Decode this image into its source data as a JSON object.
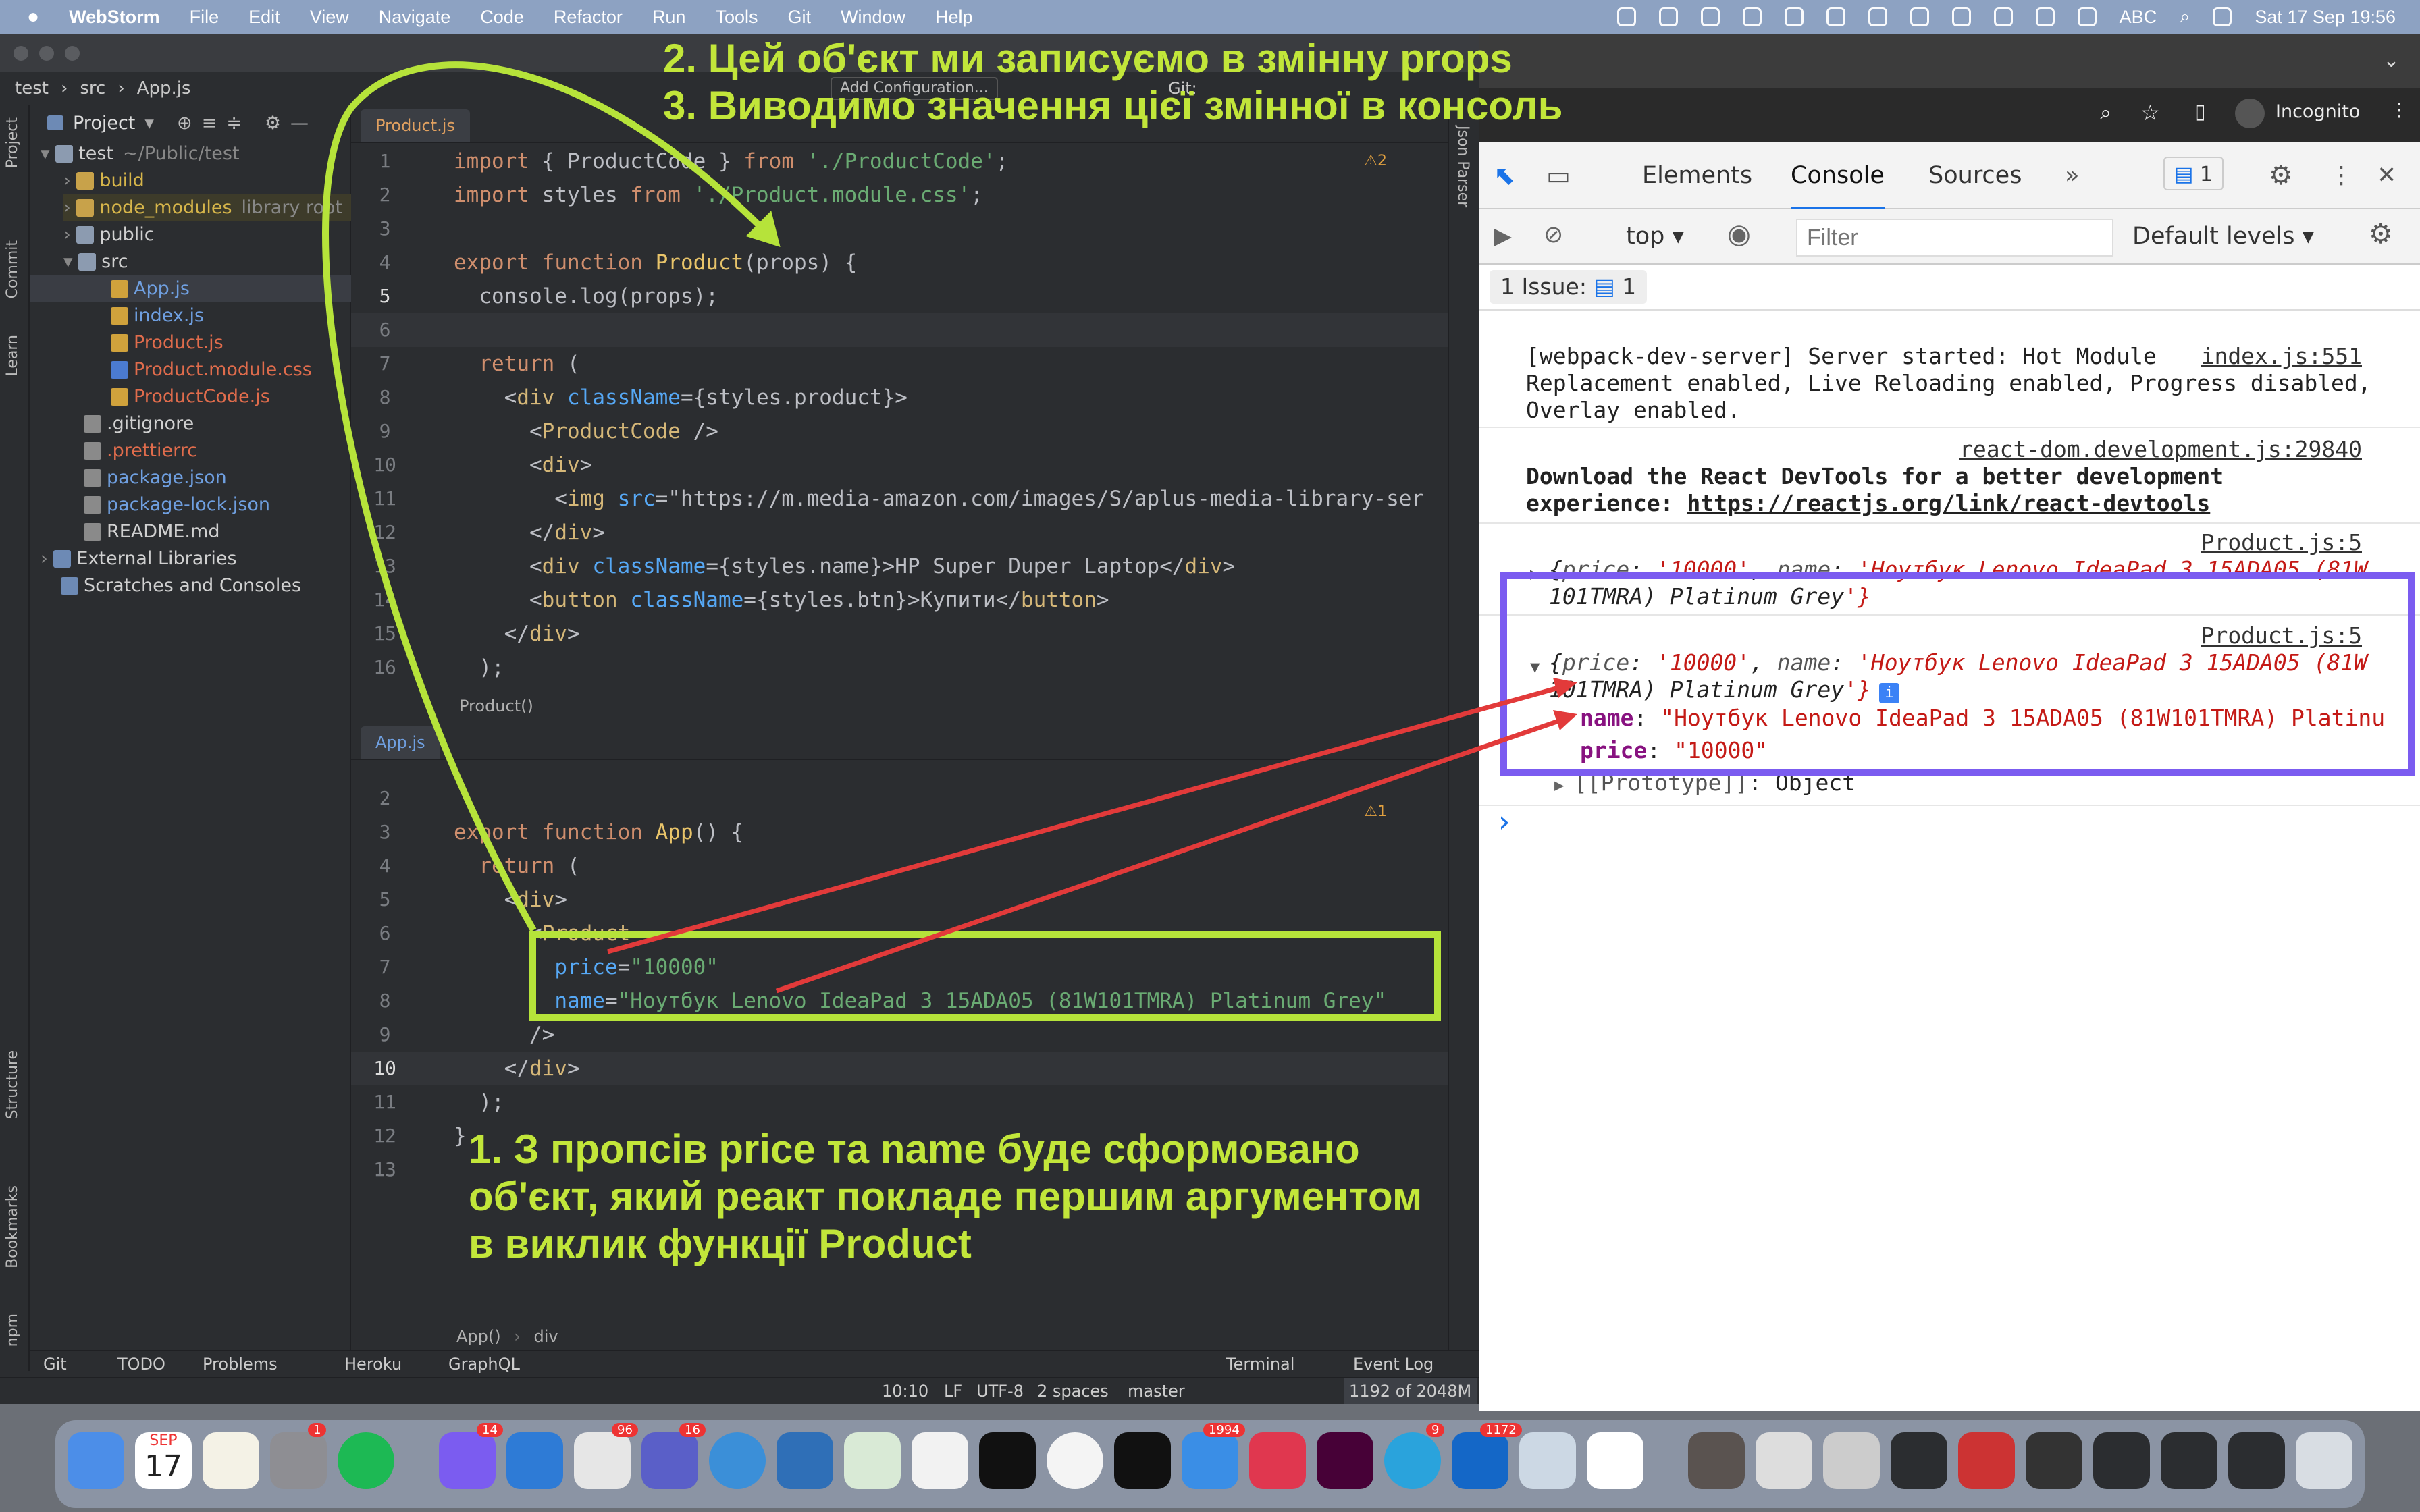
{
  "menubar": {
    "apple": "",
    "app": "WebStorm",
    "items": [
      "File",
      "Edit",
      "View",
      "Navigate",
      "Code",
      "Refactor",
      "Run",
      "Tools",
      "Git",
      "Window",
      "Help"
    ],
    "keyboard": "ABC",
    "clock": "Sat 17 Sep  19:56"
  },
  "ide": {
    "breadcrumb": [
      "test",
      "src",
      "App.js"
    ],
    "toolbar": {
      "run_config": "Add Configuration...",
      "git": "Git:"
    },
    "side_tabs": [
      "Project",
      "Commit",
      "Learn",
      "Structure",
      "Bookmarks",
      "npm"
    ],
    "project": {
      "header": "Project",
      "tree": [
        {
          "name": "test",
          "note": "~/Public/test",
          "depth": 0,
          "type": "folder",
          "open": true
        },
        {
          "name": "build",
          "depth": 1,
          "type": "folder-yellow",
          "open": false
        },
        {
          "name": "node_modules",
          "note": "library root",
          "depth": 1,
          "type": "folder-yellow",
          "open": false
        },
        {
          "name": "public",
          "depth": 1,
          "type": "folder",
          "open": false
        },
        {
          "name": "src",
          "depth": 1,
          "type": "folder",
          "open": true
        },
        {
          "name": "App.js",
          "depth": 2,
          "type": "js",
          "selected": true
        },
        {
          "name": "index.js",
          "depth": 2,
          "type": "js"
        },
        {
          "name": "Product.js",
          "depth": 2,
          "type": "js-red"
        },
        {
          "name": "Product.module.css",
          "depth": 2,
          "type": "css-red"
        },
        {
          "name": "ProductCode.js",
          "depth": 2,
          "type": "js-red"
        },
        {
          "name": ".gitignore",
          "depth": 1,
          "type": "file"
        },
        {
          "name": ".prettierrc",
          "depth": 1,
          "type": "file-red"
        },
        {
          "name": "package.json",
          "depth": 1,
          "type": "file-blue"
        },
        {
          "name": "package-lock.json",
          "depth": 1,
          "type": "file-blue"
        },
        {
          "name": "README.md",
          "depth": 1,
          "type": "file"
        },
        {
          "name": "External Libraries",
          "depth": 0,
          "type": "lib"
        },
        {
          "name": "Scratches and Consoles",
          "depth": 0,
          "type": "scratch"
        }
      ]
    },
    "editor1": {
      "tab": "Product.js",
      "warnings": "2",
      "lines": [
        "1",
        "2",
        "3",
        "4",
        "5",
        "6",
        "7",
        "8",
        "9",
        "10",
        "11",
        "12",
        "13",
        "14",
        "15",
        "16"
      ],
      "breadcrumb": "Product()"
    },
    "editor2": {
      "tab": "App.js",
      "warnings": "1",
      "lines": [
        "2",
        "3",
        "4",
        "5",
        "6",
        "7",
        "8",
        "9",
        "10",
        "11",
        "12",
        "13"
      ],
      "breadcrumb": [
        "App()",
        "div"
      ]
    },
    "code1": [
      "import { ProductCode } from './ProductCode';",
      "import styles from './Product.module.css';",
      "",
      "export function Product(props) {",
      "  console.log(props);",
      "",
      "  return (",
      "    <div className={styles.product}>",
      "      <ProductCode />",
      "      <div>",
      "        <img src=\"https://m.media-amazon.com/images/S/aplus-media-library-ser",
      "      </div>",
      "      <div className={styles.name}>HP Super Duper Laptop</div>",
      "      <button className={styles.btn}>Купити</button>",
      "    </div>",
      "  );"
    ],
    "code2": [
      "",
      "export function App() {",
      "  return (",
      "    <div>",
      "      <Product",
      "        price=\"10000\"",
      "        name=\"Ноутбук Lenovo IdeaPad 3 15ADA05 (81W101TMRA) Platinum Grey\"",
      "      />",
      "    </div>",
      "  );",
      "}",
      ""
    ],
    "tool_windows": [
      "Git",
      "TODO",
      "Problems",
      "Heroku",
      "GraphQL",
      "Terminal",
      "Event Log"
    ],
    "json_parser": "Json Parser",
    "status": {
      "pos": "10:10",
      "lf": "LF",
      "enc": "UTF-8",
      "indent": "2 spaces",
      "branch": "master",
      "mem": "1192 of 2048M"
    }
  },
  "chrome": {
    "profile": "Incognito",
    "devtools_tabs": [
      "Elements",
      "Console",
      "Sources"
    ],
    "active_tab": "Console",
    "badge_count": "1",
    "context": "top",
    "filter_placeholder": "Filter",
    "levels": "Default levels",
    "issues": {
      "label": "1 Issue:",
      "count": "1"
    },
    "console": {
      "m1": {
        "text": "[webpack-dev-server] Server started: Hot Module\nReplacement enabled, Live Reloading enabled, Progress disabled,\nOverlay enabled.",
        "src": "index.js:551"
      },
      "m2": {
        "src": "react-dom.development.js:29840",
        "bold": "Download the React DevTools for a better development\nexperience: ",
        "link": "https://reactjs.org/link/react-devtools"
      },
      "m3": {
        "src": "Product.js:5",
        "line1": "{price: '10000', name: 'Ноутбук Lenovo IdeaPad 3 15ADA05 (81W",
        "line2": "101TMRA) Platinum Grey'}"
      },
      "m4": {
        "src": "Product.js:5",
        "line1": "{price: '10000', name: 'Ноутбук Lenovo IdeaPad 3 15ADA05 (81W",
        "line2": "101TMRA) Platinum Grey'}",
        "k_name": "name",
        "v_name": "\"Ноутбук Lenovo IdeaPad 3 15ADA05 (81W101TMRA) Platinu",
        "k_price": "price",
        "v_price": "\"10000\"",
        "proto_key": "[[Prototype]]",
        "proto_val": "Object"
      },
      "prompt": "›"
    }
  },
  "annotations": {
    "top1": "2. Цей об'єкт ми записуємо в змінну props",
    "top2": "3. Виводимо значення цієї змінної в консоль",
    "bottom1": "1. З пропсів price та name буде сформовано",
    "bottom2": "об'єкт,  який реакт покладе першим аргументом",
    "bottom3": "в виклик функції Product",
    "colors": {
      "green": "#b6e33a",
      "purple": "#7b5cf0",
      "red": "#e23a3a"
    }
  },
  "dock": {
    "calendar_month": "SEP",
    "calendar_day": "17",
    "badges": [
      "1",
      "14",
      "96",
      "16",
      "1994",
      "9",
      "1172"
    ]
  }
}
